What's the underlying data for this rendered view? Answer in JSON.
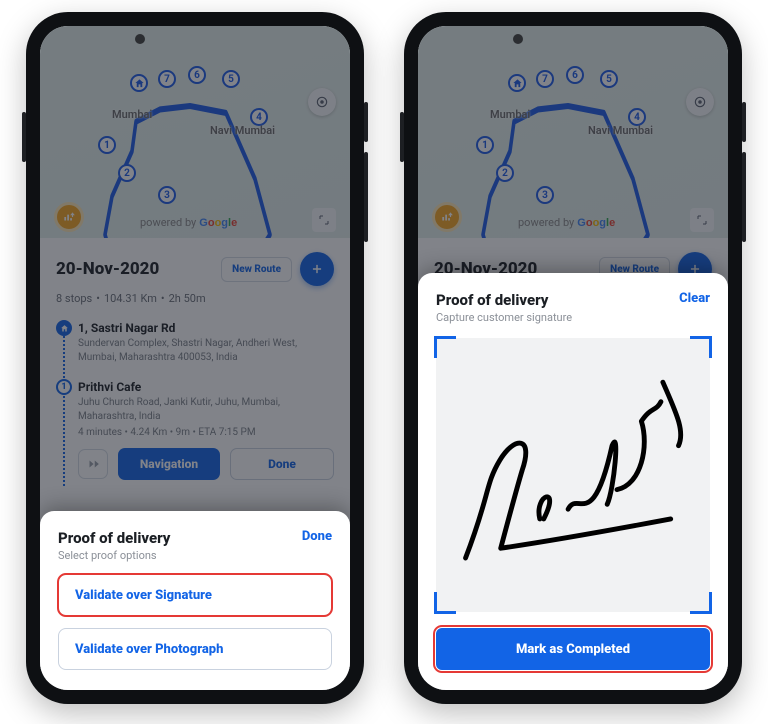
{
  "map": {
    "city_label_1": "Mumbai",
    "city_label_2": "Navi Mumbai",
    "pins": [
      "1",
      "2",
      "3",
      "4",
      "5",
      "6",
      "7"
    ],
    "brand_prefix": "powered by",
    "brand_name": "Google"
  },
  "route": {
    "date": "20-Nov-2020",
    "new_route_label": "New Route",
    "stops_count": "8 stops",
    "distance": "104.31 Km",
    "duration": "2h 50m",
    "sep": "•",
    "stop0": {
      "title": "1, Sastri Nagar Rd",
      "address": "Sundervan Complex, Shastri Nagar, Andheri West, Mumbai, Maharashtra 400053, India"
    },
    "stop1": {
      "title": "Prithvi Cafe",
      "address": "Juhu Church Road, Janki Kutir, Juhu, Mumbai, Maharashtra, India",
      "meta": "4 minutes • 4.24 Km • 9m • ETA 7:15 PM"
    },
    "nav_label": "Navigation",
    "done_label": "Done"
  },
  "pod_sheet": {
    "title": "Proof of delivery",
    "subtitle": "Select proof options",
    "done_label": "Done",
    "opt_signature": "Validate over Signature",
    "opt_photo": "Validate over Photograph"
  },
  "sig_sheet": {
    "title": "Proof of delivery",
    "subtitle": "Capture customer signature",
    "clear_label": "Clear",
    "complete_label": "Mark as Completed"
  }
}
